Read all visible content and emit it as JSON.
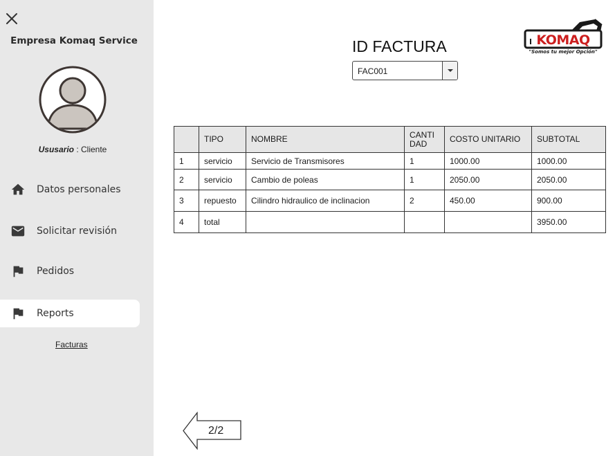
{
  "sidebar": {
    "company": "Empresa Komaq Service",
    "user_label": "Ususario",
    "user_sep": " : ",
    "user_role": "Cliente",
    "nav": [
      {
        "label": "Datos personales",
        "icon": "home-icon"
      },
      {
        "label": "Solicitar revisión",
        "icon": "mail-icon"
      },
      {
        "label": "Pedidos",
        "icon": "flag-icon"
      },
      {
        "label": "Reports",
        "icon": "flag-icon",
        "active": true
      }
    ],
    "sub_link": "Facturas"
  },
  "main": {
    "title": "ID FACTURA",
    "select_value": "FAC001",
    "logo": {
      "text": "KOMAQ",
      "tagline": "\"Somos tu mejor Opción\"",
      "accent": "#cc1f1f"
    },
    "table": {
      "headers": [
        "",
        "TIPO",
        "NOMBRE",
        "CANTI DAD",
        "COSTO UNITARIO",
        "SUBTOTAL"
      ],
      "rows": [
        [
          "1",
          "servicio",
          "Servicio de Transmisores",
          "1",
          "1000.00",
          "1000.00"
        ],
        [
          "2",
          "servicio",
          "Cambio de poleas",
          "1",
          "2050.00",
          "2050.00"
        ],
        [
          "3",
          "repuesto",
          "Cilindro hidraulico de inclinacion",
          "2",
          "450.00",
          "900.00"
        ],
        [
          "4",
          "total",
          "",
          "",
          "",
          "3950.00"
        ]
      ]
    },
    "pagination": "2/2"
  },
  "colors": {
    "sidebar_bg": "#e8e8e8",
    "header_bg": "#e6e6e6",
    "icon": "#3a3a3a"
  }
}
